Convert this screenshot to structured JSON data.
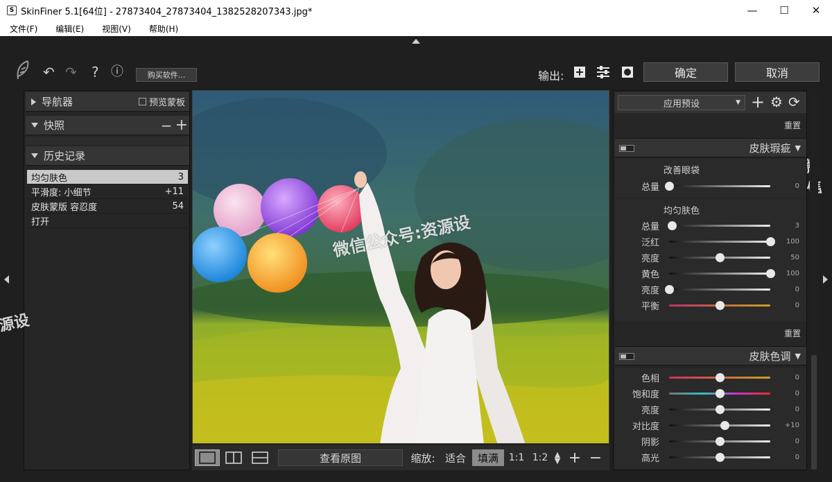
{
  "window": {
    "title": "SkinFiner 5.1[64位] - 27873404_27873404_1382528207343.jpg*",
    "app_icon_glyph": "S"
  },
  "menu": [
    "文件(F)",
    "编辑(E)",
    "视图(V)",
    "帮助(H)"
  ],
  "toolbar": {
    "buy_label": "购买软件...",
    "output_label": "输出:",
    "ok_label": "确定",
    "cancel_label": "取消"
  },
  "left": {
    "navigator": {
      "title": "导航器",
      "preview_mask": "预览蒙板"
    },
    "snapshot": {
      "title": "快照"
    },
    "history": {
      "title": "历史记录",
      "items": [
        {
          "label": "均匀肤色",
          "value": "3"
        },
        {
          "label": "平滑度: 小细节",
          "value": "+11"
        },
        {
          "label": "皮肤蒙版 容忍度",
          "value": "54"
        },
        {
          "label": "打开",
          "value": ""
        }
      ]
    }
  },
  "bottom": {
    "view_original": "查看原图",
    "zoom_label": "缩放:",
    "fit": "适合",
    "fill": "填满",
    "one_to_one": "1:1",
    "one_to_two": "1:2"
  },
  "right": {
    "preset": "应用预设",
    "reset_top": "重置",
    "blemish": {
      "title": "皮肤瑕疵",
      "eye_bags": {
        "title": "改善眼袋",
        "sliders": [
          {
            "label": "总量",
            "value": "0",
            "level": 0
          }
        ]
      },
      "even_tone": {
        "title": "均匀肤色",
        "sliders": [
          {
            "label": "总量",
            "value": "3",
            "level": 0.03
          },
          {
            "label": "泛红",
            "value": "100",
            "level": 1.0
          },
          {
            "label": "亮度",
            "value": "50",
            "level": 0.5
          },
          {
            "label": "黄色",
            "value": "100",
            "level": 1.0
          },
          {
            "label": "亮度",
            "value": "0",
            "level": 0
          },
          {
            "label": "平衡",
            "value": "0",
            "level": 0.5
          }
        ]
      },
      "reset": "重置"
    },
    "tone": {
      "title": "皮肤色调",
      "sliders": [
        {
          "label": "色相",
          "value": "0",
          "level": 0.5
        },
        {
          "label": "饱和度",
          "value": "0",
          "level": 0.5
        },
        {
          "label": "亮度",
          "value": "0",
          "level": 0.5
        },
        {
          "label": "对比度",
          "value": "+10",
          "level": 0.55
        },
        {
          "label": "阴影",
          "value": "0",
          "level": 0.5
        },
        {
          "label": "高光",
          "value": "0",
          "level": 0.5
        }
      ]
    }
  },
  "watermarks": [
    "微信公众号:资源设",
    "微信",
    "源设"
  ],
  "colors": {
    "accent": "#c9c9c9",
    "panel": "#262626",
    "header": "#353535"
  }
}
